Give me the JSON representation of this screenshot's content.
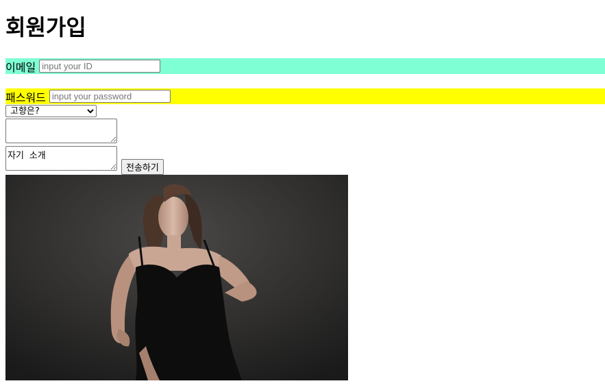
{
  "page_title": "회원가입",
  "email": {
    "label": "이메일",
    "placeholder": "input your ID",
    "value": "",
    "bg_color": "#7fffd4"
  },
  "password": {
    "label": "패스워드",
    "placeholder": "input your password",
    "value": "",
    "bg_color": "#ffff00"
  },
  "hometown_select": {
    "selected": "고향은?"
  },
  "textarea_empty": {
    "value": ""
  },
  "intro_textarea": {
    "value": "자기 소개"
  },
  "submit_label": "전송하기"
}
